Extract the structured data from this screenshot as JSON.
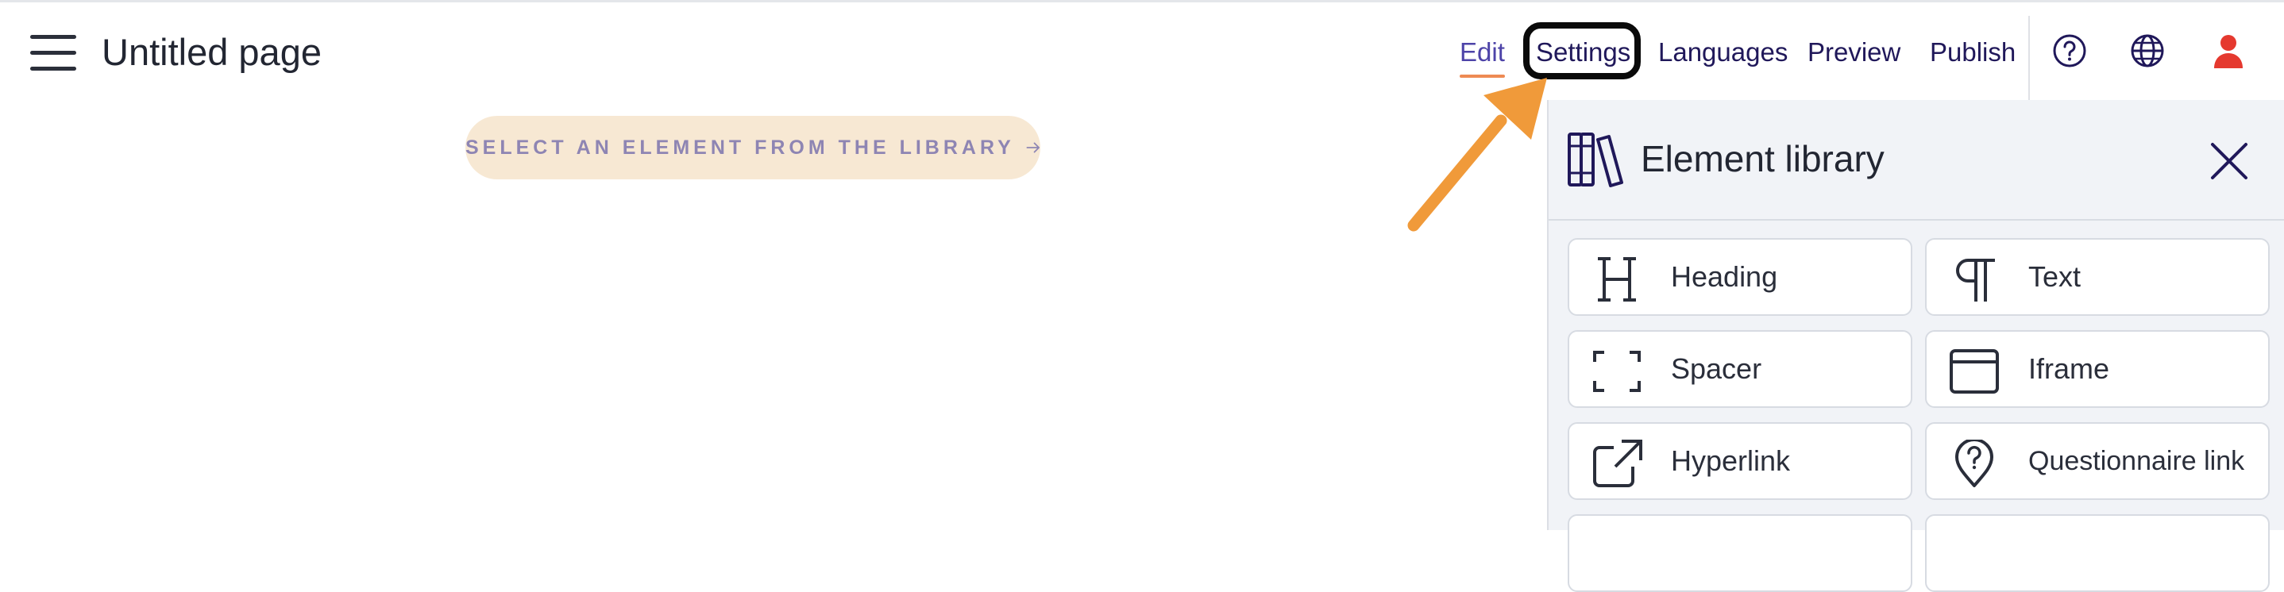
{
  "header": {
    "menu_icon": "hamburger-menu-icon",
    "page_title": "Untitled page",
    "nav": {
      "edit": "Edit",
      "settings": "Settings",
      "languages": "Languages",
      "preview": "Preview",
      "publish": "Publish"
    },
    "icons": [
      "help-icon",
      "globe-icon",
      "user-icon"
    ],
    "colors": {
      "nav_text": "#20185a",
      "active_nav": "#4d43a8",
      "active_underline": "#ee8a53",
      "user_icon": "#e5392f"
    }
  },
  "canvas": {
    "select_prompt": "SELECT AN ELEMENT FROM THE LIBRARY",
    "prompt_icon": "arrow-right-icon",
    "prompt_bg": "#f7e8d3"
  },
  "annotation": {
    "arrow_color": "#f09a3a",
    "highlight_target": "Settings"
  },
  "library": {
    "title": "Element library",
    "title_icon": "books-icon",
    "close_icon": "close-icon",
    "elements": [
      {
        "label": "Heading",
        "icon": "heading-icon"
      },
      {
        "label": "Text",
        "icon": "paragraph-icon"
      },
      {
        "label": "Spacer",
        "icon": "spacer-icon"
      },
      {
        "label": "Iframe",
        "icon": "iframe-icon"
      },
      {
        "label": "Hyperlink",
        "icon": "external-link-icon"
      },
      {
        "label": "Questionnaire link",
        "icon": "questionnaire-pin-icon"
      }
    ]
  }
}
